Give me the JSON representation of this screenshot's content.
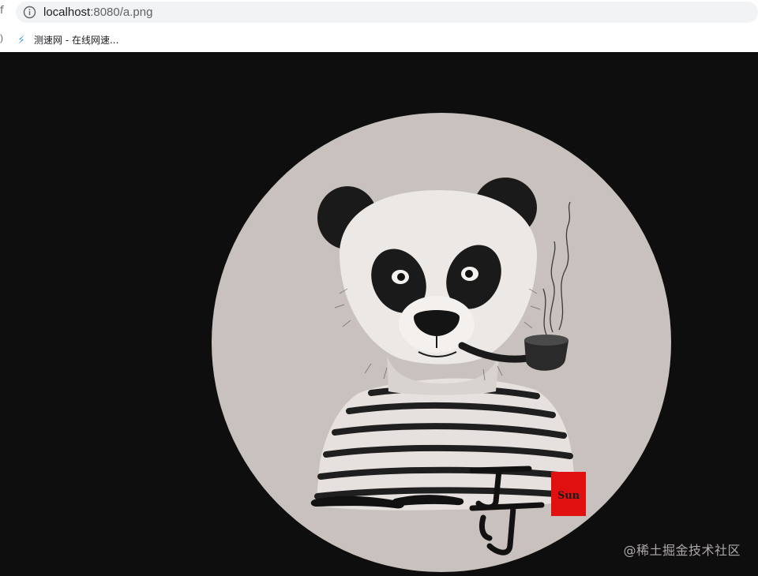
{
  "browser": {
    "url_host": "localhost",
    "url_rest": ":8080/a.png",
    "edge_glyph": "f",
    "bookmark_edge_glyph": ")"
  },
  "bookmarks": [
    {
      "label": "测速网 - 在线网速...",
      "icon": "s-logo-icon"
    }
  ],
  "image": {
    "calligraphy_text": "一一哥",
    "seal_text": "Sun",
    "background_color": "#0e0e0e",
    "circle_color": "#c8c1be",
    "seal_color": "#e01010"
  },
  "watermark": "@稀土掘金技术社区"
}
